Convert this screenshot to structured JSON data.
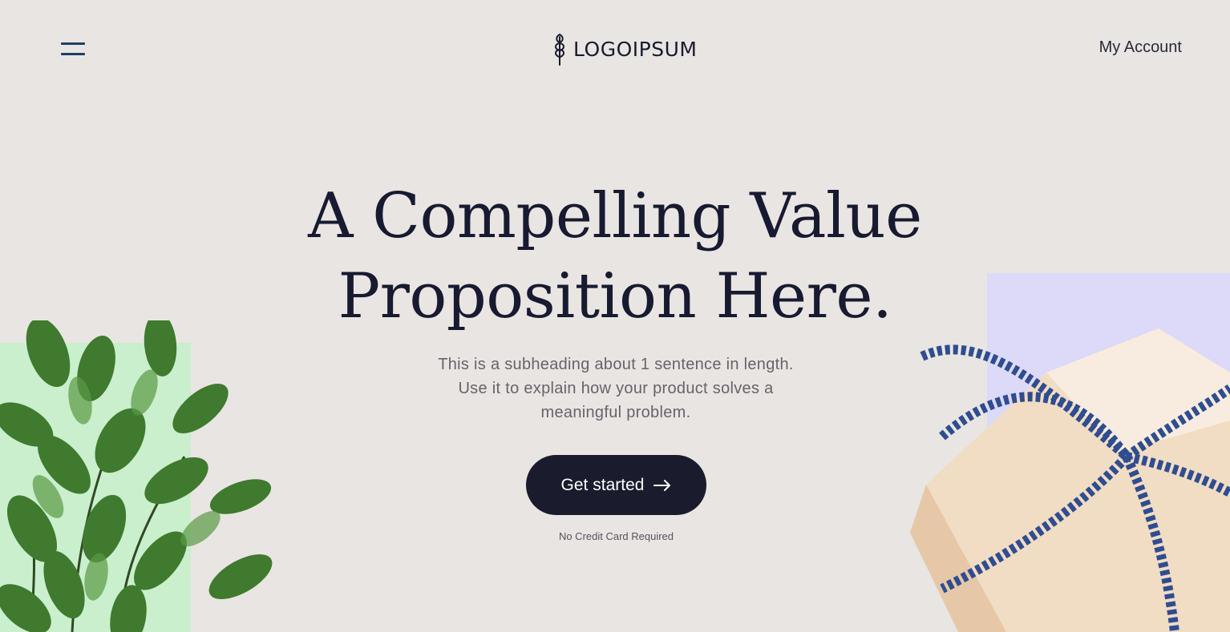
{
  "header": {
    "logo_text": "LOGOIPSUM",
    "account_label": "My Account",
    "menu_icon": "hamburger-icon"
  },
  "hero": {
    "title_line1": "A Compelling Value",
    "title_line2": "Proposition Here.",
    "subheading": "This is a subheading about 1 sentence in length. Use it to explain how your product solves a meaningful problem.",
    "cta_label": "Get started",
    "cta_icon": "arrow-right-icon",
    "note": "No Credit Card Required"
  },
  "colors": {
    "background": "#e9e5e2",
    "text_dark": "#171a30",
    "button_bg": "#1a1c2e",
    "menu_accent": "#1d3f66",
    "plant_panel": "#c9efcd",
    "gift_panel": "#dcd9f9"
  }
}
